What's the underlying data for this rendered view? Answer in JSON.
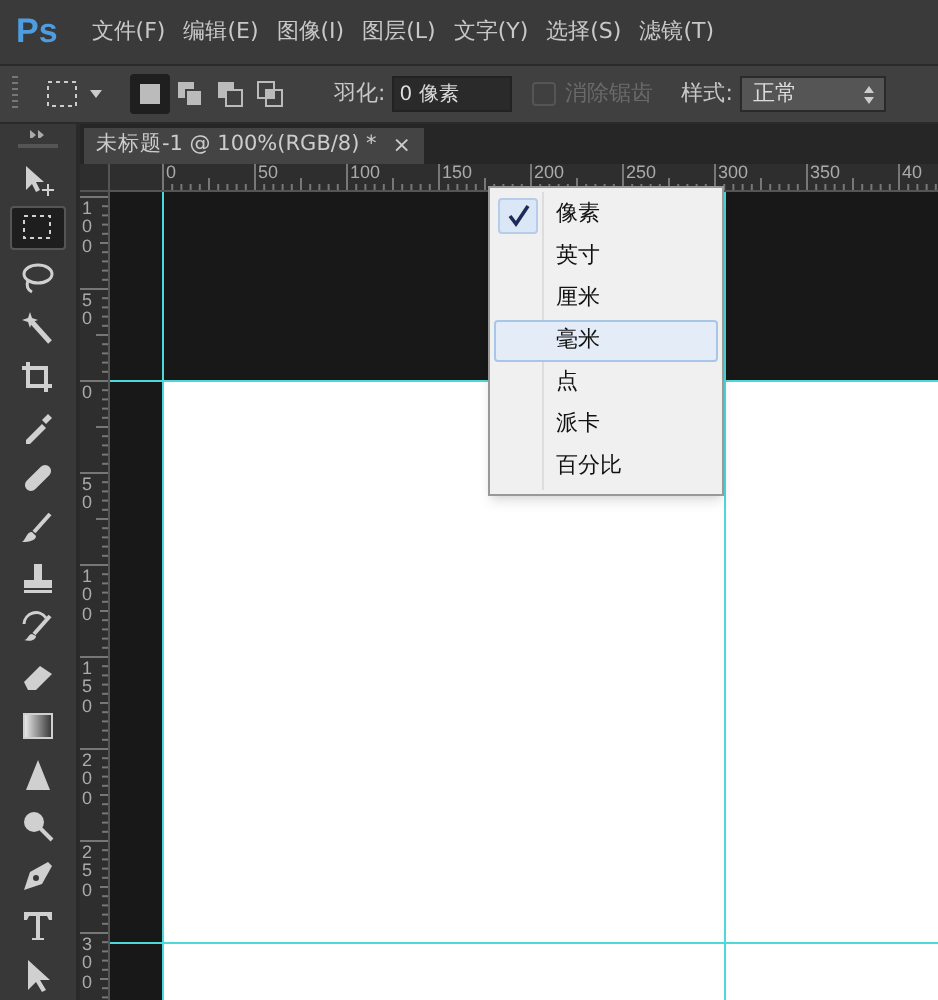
{
  "menu_bar": {
    "logo": "Ps",
    "items": [
      "文件(F)",
      "编辑(E)",
      "图像(I)",
      "图层(L)",
      "文字(Y)",
      "选择(S)",
      "滤镜(T)"
    ]
  },
  "options_bar": {
    "selection_modes": [
      {
        "kind": "new",
        "selected": true
      },
      {
        "kind": "add",
        "selected": false
      },
      {
        "kind": "subtract",
        "selected": false
      },
      {
        "kind": "intersect",
        "selected": false
      }
    ],
    "feather_label": "羽化:",
    "feather_value": "0 像素",
    "antialias": {
      "label": "消除锯齿",
      "checked": false,
      "disabled": true
    },
    "style_label": "样式:",
    "style_value": "正常"
  },
  "document_tab": {
    "title": "未标题-1 @ 100%(RGB/8) *",
    "close": "×"
  },
  "tools": [
    {
      "kind": "move",
      "selected": false
    },
    {
      "kind": "marquee",
      "selected": true
    },
    {
      "kind": "lasso",
      "selected": false
    },
    {
      "kind": "wand",
      "selected": false
    },
    {
      "kind": "crop",
      "selected": false
    },
    {
      "kind": "eyedropper",
      "selected": false
    },
    {
      "kind": "healing",
      "selected": false
    },
    {
      "kind": "brush",
      "selected": false
    },
    {
      "kind": "stamp",
      "selected": false
    },
    {
      "kind": "history",
      "selected": false
    },
    {
      "kind": "eraser",
      "selected": false
    },
    {
      "kind": "gradient",
      "selected": false
    },
    {
      "kind": "sharpen",
      "selected": false
    },
    {
      "kind": "dodge",
      "selected": false
    },
    {
      "kind": "pen",
      "selected": false
    },
    {
      "kind": "type",
      "selected": false
    },
    {
      "kind": "select",
      "selected": false
    }
  ],
  "rulers": {
    "horizontal": [
      "0",
      "50",
      "100",
      "150",
      "200",
      "250",
      "300",
      "350",
      "40"
    ],
    "vertical": [
      "100",
      "50",
      "0",
      "50",
      "100",
      "150",
      "200",
      "250",
      "300"
    ]
  },
  "unit_menu": {
    "items": [
      {
        "label": "像素",
        "checked": true,
        "selected": false
      },
      {
        "label": "英寸",
        "checked": false,
        "selected": false
      },
      {
        "label": "厘米",
        "checked": false,
        "selected": false
      },
      {
        "label": "毫米",
        "checked": false,
        "selected": true
      },
      {
        "label": "点",
        "checked": false,
        "selected": false
      },
      {
        "label": "派卡",
        "checked": false,
        "selected": false
      },
      {
        "label": "百分比",
        "checked": false,
        "selected": false
      }
    ]
  }
}
